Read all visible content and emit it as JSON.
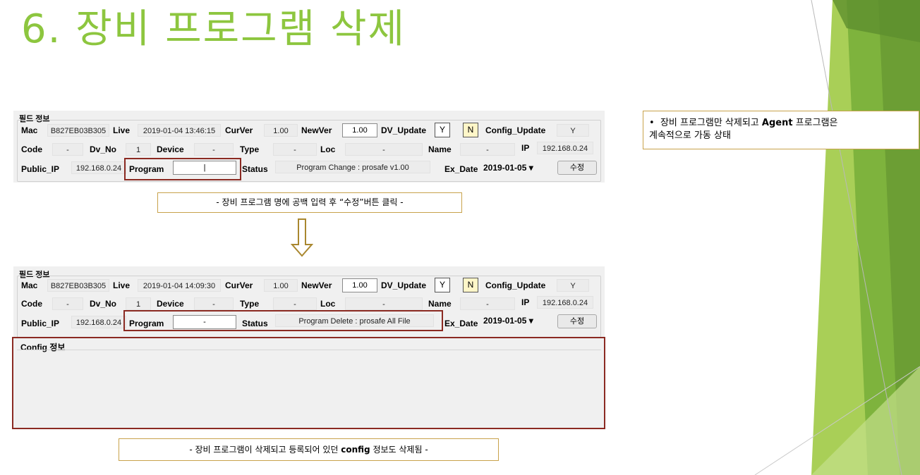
{
  "slide": {
    "title": "6. 장비 프로그램 삭제",
    "accent_color": "#8DC63F",
    "border_color": "#8B2A22",
    "caption_border": "#C8A24B"
  },
  "panel1": {
    "section": "필드 정보",
    "labels": {
      "mac": "Mac",
      "live": "Live",
      "curver": "CurVer",
      "newver": "NewVer",
      "dv_update": "DV_Update",
      "config_update": "Config_Update",
      "code": "Code",
      "dv_no": "Dv_No",
      "device": "Device",
      "type": "Type",
      "loc": "Loc",
      "name": "Name",
      "ip": "IP",
      "public_ip": "Public_IP",
      "program": "Program",
      "status": "Status",
      "ex_date": "Ex_Date"
    },
    "values": {
      "mac": "B827EB03B305",
      "live": "2019-01-04 13:46:15",
      "curver": "1.00",
      "newver": "1.00",
      "y": "Y",
      "n": "N",
      "config_update": "Y",
      "code": "-",
      "dv_no": "1",
      "device": "-",
      "type": "-",
      "loc": "-",
      "name": "-",
      "ip": "192.168.0.24",
      "public_ip": "192.168.0.24",
      "program": "|",
      "status": "Program Change : prosafe v1.00",
      "ex_date": "2019-01-05",
      "modify_button": "수정"
    }
  },
  "caption1": "- 장비 프로그램 명에 공백 입력 후 “수정”버튼 클릭 -",
  "arrow_icon": "down-arrow-icon",
  "panel2": {
    "section": "필드 정보",
    "values": {
      "mac": "B827EB03B305",
      "live": "2019-01-04 14:09:30",
      "curver": "1.00",
      "newver": "1.00",
      "y": "Y",
      "n": "N",
      "config_update": "Y",
      "code": "-",
      "dv_no": "1",
      "device": "-",
      "type": "-",
      "loc": "-",
      "name": "-",
      "ip": "192.168.0.24",
      "public_ip": "192.168.0.24",
      "program": "-",
      "status": "Program Delete : prosafe All File",
      "ex_date": "2019-01-05",
      "modify_button": "수정"
    },
    "config_section": "Config 정보"
  },
  "caption2": {
    "prefix": "- 장비 프로그램이 삭제되고 등록되어 있던 ",
    "bold": "config",
    "suffix": " 정보도 삭제됨 -"
  },
  "note": {
    "bullet": "•",
    "line1_a": "장비 프로그램만 삭제되고 ",
    "line1_b": "Agent",
    "line1_c": " 프로그램은",
    "line2": "계속적으로 가동 상태"
  }
}
